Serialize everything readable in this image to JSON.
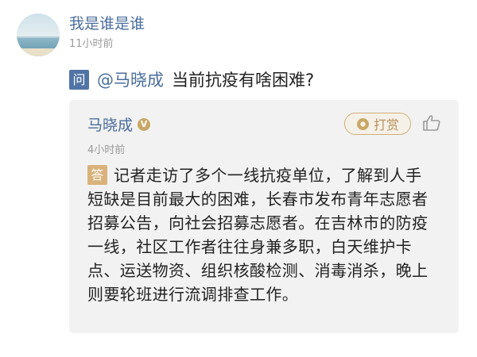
{
  "post": {
    "author": "我是谁是谁",
    "time": "11小时前"
  },
  "question": {
    "tag": "问",
    "mention": "@马晓成",
    "text": "当前抗疫有啥困难?"
  },
  "answer": {
    "responder": "马晓成",
    "verified_badge": "V",
    "tip_label": "打赏",
    "time": "4小时前",
    "tag": "答",
    "text": "记者走访了多个一线抗疫单位，了解到人手短缺是目前最大的困难，长春市发布青年志愿者招募公告，向社会招募志愿者。在吉林市的防疫一线，社区工作者往往身兼多职，白天维护卡点、运送物资、组织核酸检测、消毒消杀，晚上则要轮班进行流调排查工作。"
  },
  "icons": {
    "avatar": "landscape-avatar-icon",
    "verified": "verified-badge-icon",
    "tip": "tip-coin-icon",
    "like": "thumbs-up-icon"
  },
  "colors": {
    "link_blue": "#4a6d9e",
    "question_tag": "#5174a6",
    "answer_tag": "#d8b27a",
    "gold": "#c9a866",
    "card_bg": "#f2f2f2",
    "muted": "#9a9a9a"
  }
}
